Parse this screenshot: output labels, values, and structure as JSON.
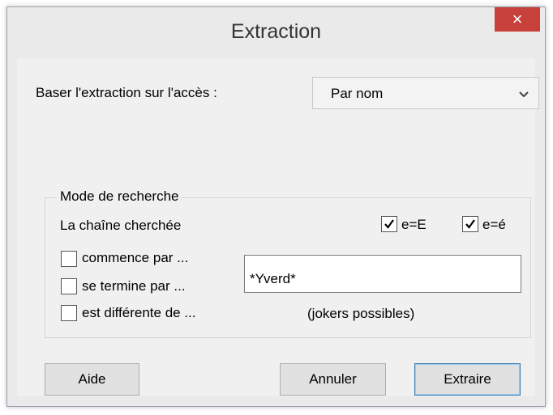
{
  "window": {
    "title": "Extraction",
    "close_glyph": "×"
  },
  "base": {
    "label": "Baser l'extraction sur l'accès :",
    "select_value": "Par nom"
  },
  "group": {
    "title": "Mode de recherche",
    "subtitle": "La chaîne cherchée",
    "case_option": {
      "label": "e=E",
      "checked": true
    },
    "accent_option": {
      "label": "e=é",
      "checked": true
    },
    "options": [
      {
        "label": "commence par ...",
        "checked": false
      },
      {
        "label": "se termine par ...",
        "checked": false
      },
      {
        "label": "est différente de ...",
        "checked": false
      }
    ],
    "search_value": "*Yverd*",
    "hint": "(jokers possibles)"
  },
  "buttons": {
    "help": "Aide",
    "cancel": "Annuler",
    "extract": "Extraire"
  },
  "colors": {
    "close_red": "#c7413a",
    "default_button_border": "#3c7fb1"
  }
}
